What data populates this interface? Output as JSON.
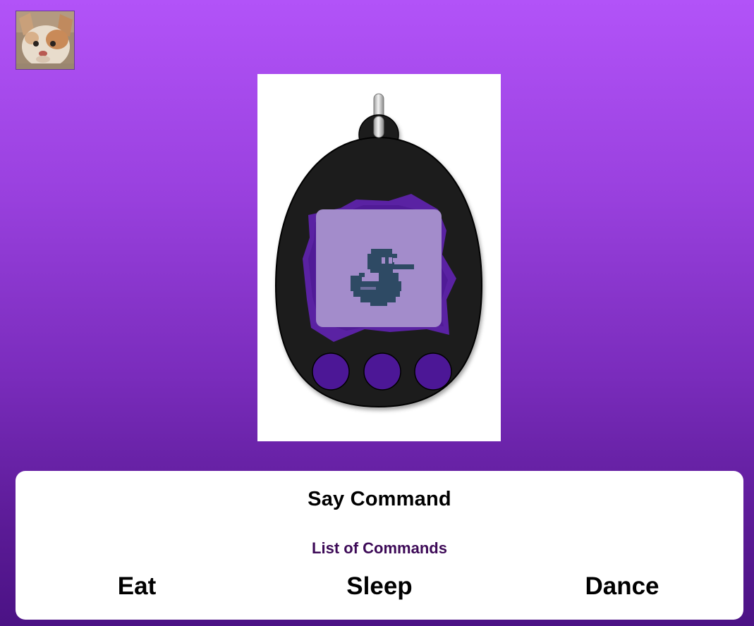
{
  "colors": {
    "background_top": "#b253f8",
    "background_bottom": "#4b1285",
    "panel": "#ffffff",
    "list_title": "#3d0a57",
    "device_body": "#1c1c1c",
    "device_button": "#4c1796",
    "screen": "#a38ccb",
    "screen_backdrop": "#5a22a3",
    "pet_sprite": "#2e4a64"
  },
  "avatar": {
    "icon": "cat-photo-icon"
  },
  "device": {
    "icon": "tamagotchi-device-icon",
    "pet_icon": "pixel-duck-icon",
    "button_count": 3
  },
  "panel": {
    "say_command_label": "Say Command",
    "list_title": "List of Commands",
    "commands": [
      "Eat",
      "Sleep",
      "Dance"
    ]
  }
}
